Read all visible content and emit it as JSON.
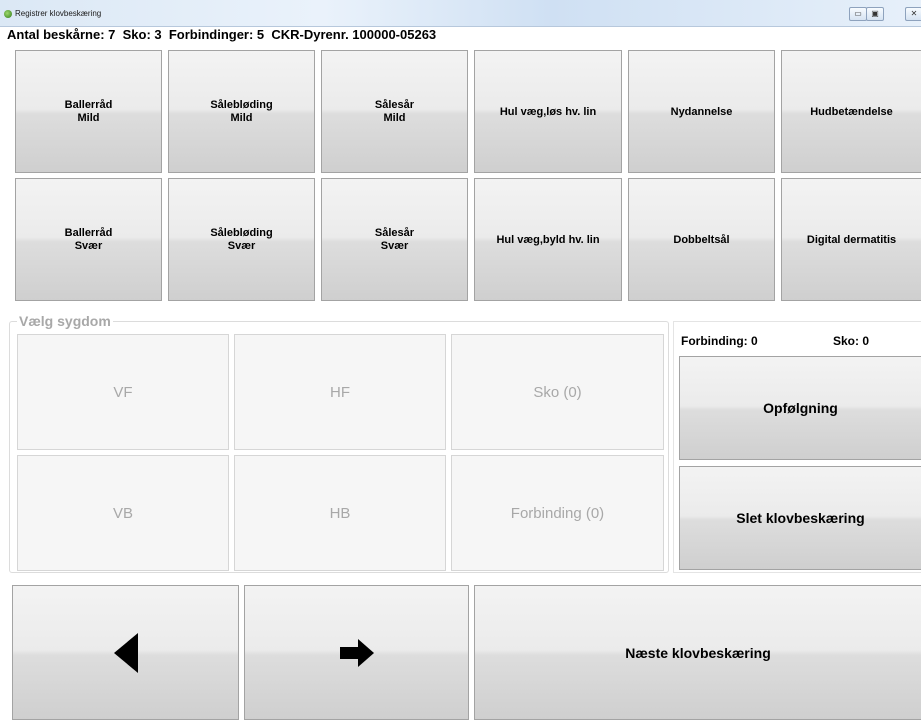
{
  "window": {
    "title": "Registrer klovbeskæring",
    "minimize": "▭",
    "maximize": "▣",
    "close": "✕"
  },
  "info": {
    "text": "Antal beskårne: 7  Sko: 3  Forbindinger: 5  CKR-Dyrenr. 100000-05263"
  },
  "diagnosis_row1": [
    {
      "line1": "Ballerråd",
      "line2": "Mild"
    },
    {
      "line1": "Sålebløding",
      "line2": "Mild"
    },
    {
      "line1": "Sålesår",
      "line2": "Mild"
    },
    {
      "line1": "Hul væg,løs hv. lin",
      "line2": ""
    },
    {
      "line1": "Nydannelse",
      "line2": ""
    },
    {
      "line1": "Hudbetændelse",
      "line2": ""
    }
  ],
  "diagnosis_row2": [
    {
      "line1": "Ballerråd",
      "line2": "Svær"
    },
    {
      "line1": "Sålebløding",
      "line2": "Svær"
    },
    {
      "line1": "Sålesår",
      "line2": "Svær"
    },
    {
      "line1": "Hul væg,byld hv. lin",
      "line2": ""
    },
    {
      "line1": "Dobbeltsål",
      "line2": ""
    },
    {
      "line1": "Digital dermatitis",
      "line2": ""
    }
  ],
  "select_disease": {
    "label": "Vælg sygdom",
    "vf": "VF",
    "hf": "HF",
    "sko": "Sko (0)",
    "vb": "VB",
    "hb": "HB",
    "forbinding": "Forbinding (0)"
  },
  "side_panel": {
    "forbinding_count": "Forbinding: 0",
    "sko_count": "Sko: 0",
    "followup_button": "Opfølgning",
    "delete_button": "Slet klovbeskæring"
  },
  "nav": {
    "back_icon": "triangle-left",
    "forward_icon": "arrow-right",
    "next_button": "Næste klovbeskæring"
  }
}
